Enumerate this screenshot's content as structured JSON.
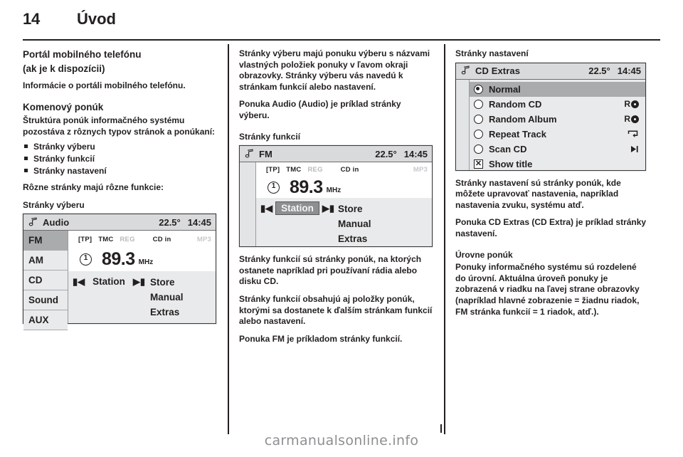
{
  "header": {
    "page_number": "14",
    "chapter": "Úvod"
  },
  "footer": {
    "watermark": "carmanualsonline.info"
  },
  "col1": {
    "h_portal": "Portál mobilného telefónu",
    "h_portal2": "(ak je k dispozícii)",
    "p_portal": "Informácie o portáli mobilného telefónu.",
    "h_menu": "Komenový ponúk",
    "p_struct": "Štruktúra ponúk informačného systému pozostáva z rôznych typov stránok a ponúkaní:",
    "bullets": [
      "Stránky výberu",
      "Stránky funkcií",
      "Stránky nastavení"
    ],
    "p_diff": "Rôzne stránky majú rôzne funkcie:",
    "h_select": "Stránky výberu"
  },
  "col2": {
    "p_select_1": "Stránky výberu majú ponuku výberu s názvami vlastných položiek ponuky v ľavom okraji obrazovky. Stránky výberu vás navedú k stránkam funkcií alebo nastavení.",
    "p_select_2": "Ponuka Audio (Audio) je príklad stránky výberu.",
    "h_func": "Stránky funkcií",
    "p_func_1": "Stránky funkcií sú stránky ponúk, na ktorých ostanete napríklad pri používaní rádia alebo disku CD.",
    "p_func_2": "Stránky funkcií obsahujú aj položky ponúk, ktorými sa dostanete k ďalším stránkam funkcií alebo nastavení.",
    "p_func_3": "Ponuka FM je príkladom stránky funkcií."
  },
  "col3": {
    "h_settings": "Stránky nastavení",
    "p_settings_1": "Stránky nastavení sú stránky ponúk, kde môžete upravovať nastavenia, napríklad nastavenia zvuku, systému atď.",
    "p_settings_2": "Ponuka CD Extras (CD Extra) je príklad stránky nastavení.",
    "h_levels": "Úrovne ponúk",
    "p_levels": "Ponuky informačného systému sú rozdelené do úrovní. Aktuálna úroveň ponuky je zobrazená v riadku na ľavej strane obrazovky (napríklad hlavné zobrazenie = žiadnu riadok, FM stránka funkcií = 1 riadok, atď.)."
  },
  "screen_audio": {
    "icon": "music-note-icon",
    "title": "Audio",
    "temperature": "22.5°",
    "clock": "14:45",
    "menu": [
      {
        "label": "FM",
        "selected": true
      },
      {
        "label": "AM",
        "selected": false
      },
      {
        "label": "CD",
        "selected": false
      },
      {
        "label": "Sound",
        "selected": false
      },
      {
        "label": "AUX",
        "selected": false
      }
    ],
    "flags": [
      {
        "label": "[TP]",
        "dim": false
      },
      {
        "label": "TMC",
        "dim": false
      },
      {
        "label": "REG",
        "dim": true
      },
      {
        "label": "CD in",
        "dim": false
      },
      {
        "label": "MP3",
        "dim": true
      }
    ],
    "preset": "1",
    "frequency": "89.3",
    "unit": "MHz",
    "prev_icon": "skip-back-icon",
    "next_icon": "skip-forward-icon",
    "station_label": "Station",
    "station_highlighted": false,
    "actions": [
      "Store",
      "Manual",
      "Extras"
    ]
  },
  "screen_fm": {
    "icon": "music-note-icon",
    "title": "FM",
    "temperature": "22.5°",
    "clock": "14:45",
    "flags": [
      {
        "label": "[TP]",
        "dim": false
      },
      {
        "label": "TMC",
        "dim": false
      },
      {
        "label": "REG",
        "dim": true
      },
      {
        "label": "CD in",
        "dim": false
      },
      {
        "label": "MP3",
        "dim": true
      }
    ],
    "preset": "1",
    "frequency": "89.3",
    "unit": "MHz",
    "prev_icon": "skip-back-icon",
    "next_icon": "skip-forward-icon",
    "station_label": "Station",
    "station_highlighted": true,
    "actions": [
      "Store",
      "Manual",
      "Extras"
    ]
  },
  "screen_cdextras": {
    "icon": "music-note-icon",
    "title": "CD Extras",
    "temperature": "22.5°",
    "clock": "14:45",
    "rows": [
      {
        "label": "Normal",
        "control": "radio",
        "on": true,
        "selected": true,
        "right": "",
        "right_icon": ""
      },
      {
        "label": "Random CD",
        "control": "radio",
        "on": false,
        "selected": false,
        "right": "R",
        "right_icon": "random-dot-icon"
      },
      {
        "label": "Random Album",
        "control": "radio",
        "on": false,
        "selected": false,
        "right": "R",
        "right_icon": "random-dot-icon"
      },
      {
        "label": "Repeat Track",
        "control": "radio",
        "on": false,
        "selected": false,
        "right": "↵",
        "right_icon": "repeat-icon"
      },
      {
        "label": "Scan CD",
        "control": "radio",
        "on": false,
        "selected": false,
        "right": "▶|",
        "right_icon": "scan-icon"
      },
      {
        "label": "Show title",
        "control": "checkbox",
        "on": true,
        "selected": false,
        "right": "",
        "right_icon": ""
      }
    ],
    "checkbox_glyph": "✕"
  },
  "colors": {
    "ink": "#231f20",
    "screen_bg": "#e9eaeb",
    "screen_header": "#d9dadb",
    "highlight": "#a9abad",
    "white_panel": "#ffffff",
    "dim_text": "#b7b9bb",
    "watermark": "#8d8f91"
  }
}
